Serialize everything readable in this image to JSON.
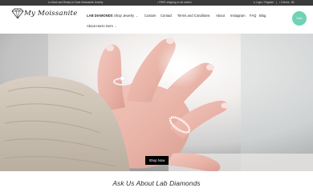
{
  "topbar": {
    "left_text": "In-Stock and Ready to Order Moissanite Jewelry",
    "center_text": "FREE shipping on all orders!",
    "right_login": "Login / Register",
    "right_cart": "0 items - $0"
  },
  "header": {
    "logo_text": "My Moissanite",
    "nav": [
      {
        "label": "LAB DIAMONDS",
        "bold": true
      },
      {
        "label": "Shop Jewelry",
        "has_caret": true
      },
      {
        "label": "Custom"
      },
      {
        "label": "Contact"
      },
      {
        "label": "Terms and Conditions"
      },
      {
        "label": "About"
      },
      {
        "label": "Instagram"
      },
      {
        "label": "FAQ"
      },
      {
        "label": "Blog"
      },
      {
        "label": "About Harro Gem",
        "has_caret": true
      }
    ],
    "cart_bubble_text": "Cart"
  },
  "hero": {
    "button_label": "Shop Now"
  },
  "section": {
    "title": "Ask Us About Lab Diamonds"
  },
  "colors": {
    "topbar_bg": "#3a3a3a",
    "accent_mint": "#6fd3b6",
    "button_bg": "#000000"
  }
}
